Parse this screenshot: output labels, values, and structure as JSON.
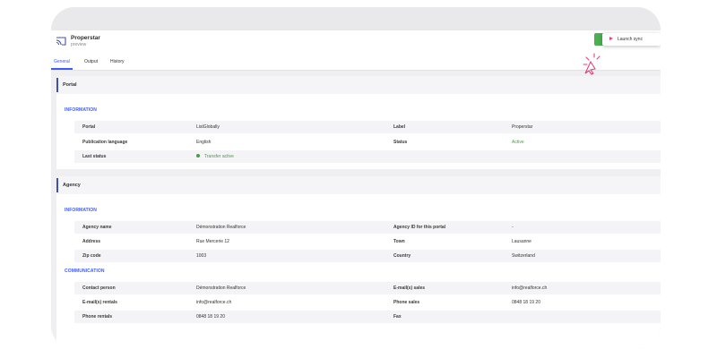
{
  "app": {
    "title": "Properstar",
    "subtitle": "preview"
  },
  "header": {
    "launch_sync_label": "Launch sync",
    "colors": {
      "primary": "#3f51b5",
      "success": "#4caf50",
      "cursor": "#e2427f"
    }
  },
  "tabs": [
    {
      "label": "General",
      "active": true
    },
    {
      "label": "Output"
    },
    {
      "label": "History"
    }
  ],
  "portal": {
    "title": "Portal",
    "section": "INFORMATION",
    "rows": [
      {
        "l1": "Portal",
        "v1": "ListGlobally",
        "l2": "Label",
        "v2": "Properstar"
      },
      {
        "l1": "Publication language",
        "v1": "English",
        "l2": "Status",
        "v2": "Active"
      },
      {
        "l1": "Last status",
        "v1": "Transfer active"
      }
    ]
  },
  "agency": {
    "title": "Agency",
    "section_info": "INFORMATION",
    "info_rows": [
      {
        "l1": "Agency name",
        "v1": "Démonstration Realforce",
        "l2": "Agency ID for this portal",
        "v2": "-"
      },
      {
        "l1": "Address",
        "v1": "Rue Mercerie 12",
        "l2": "Town",
        "v2": "Lausanne"
      },
      {
        "l1": "Zip code",
        "v1": "1003",
        "l2": "Country",
        "v2": "Switzerland"
      }
    ],
    "section_comm": "COMMUNICATION",
    "comm_rows": [
      {
        "l1": "Contact person",
        "v1": "Démonstration Realforce",
        "l2": "E-mail(s) sales",
        "v2": "info@realforce.ch"
      },
      {
        "l1": "E-mail(s) rentals",
        "v1": "info@realforce.ch",
        "l2": "Phone sales",
        "v2": "0848 18 19 20"
      },
      {
        "l1": "Phone rentals",
        "v1": "0848 18 19 20",
        "l2": "Fax",
        "v2": ""
      }
    ]
  }
}
